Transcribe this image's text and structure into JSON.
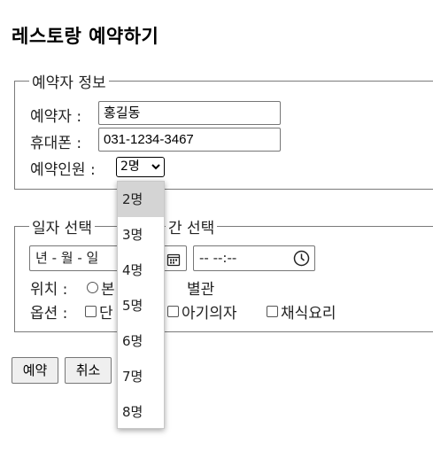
{
  "page": {
    "title": "레스토랑 예약하기"
  },
  "booker_info": {
    "legend": "예약자 정보",
    "name_label": "예약자 :",
    "name_value": "홍길동",
    "phone_label": "휴대폰 :",
    "phone_value": "031-1234-3467",
    "guests_label": "예약인원 :",
    "guests_selected": "2명",
    "guests_options": [
      "2명",
      "3명",
      "4명",
      "5명",
      "6명",
      "7명",
      "8명"
    ]
  },
  "schedule": {
    "legend_left": "일자 선택",
    "legend_right": "간 선택",
    "date_placeholder": "년 - 월 - 일",
    "time_placeholder": "-- --:--",
    "location_label": "위치 :",
    "location_options": [
      "본",
      "별관"
    ],
    "options_label": "옵션 :",
    "extras": [
      "단",
      "아기의자",
      "채식요리"
    ]
  },
  "actions": {
    "submit_label": "예약",
    "cancel_label": "취소"
  },
  "colors": {
    "selected_option_bg": "#d4d4d4",
    "button_bg": "#efefef",
    "fieldset_border": "#7a7a7a"
  }
}
